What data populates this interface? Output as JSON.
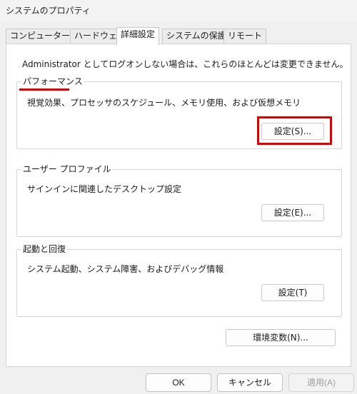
{
  "window": {
    "title": "システムのプロパティ"
  },
  "tabs": [
    {
      "label": "コンピューター名"
    },
    {
      "label": "ハードウェア"
    },
    {
      "label": "詳細設定"
    },
    {
      "label": "システムの保護"
    },
    {
      "label": "リモート"
    }
  ],
  "notice": "Administrator としてログオンしない場合は、これらのほとんどは変更できません。",
  "performance": {
    "label": "パフォーマンス",
    "description": "視覚効果、プロセッサのスケジュール、メモリ使用、および仮想メモリ",
    "button": "設定(S)..."
  },
  "user_profile": {
    "label": "ユーザー プロファイル",
    "description": "サインインに関連したデスクトップ設定",
    "button": "設定(E)..."
  },
  "startup": {
    "label": "起動と回復",
    "description": "システム起動、システム障害、およびデバッグ情報",
    "button": "設定(T)"
  },
  "env_button": "環境変数(N)...",
  "footer": {
    "ok": "OK",
    "cancel": "キャンセル",
    "apply": "適用(A)"
  },
  "colors": {
    "annotation": "#e00000"
  }
}
